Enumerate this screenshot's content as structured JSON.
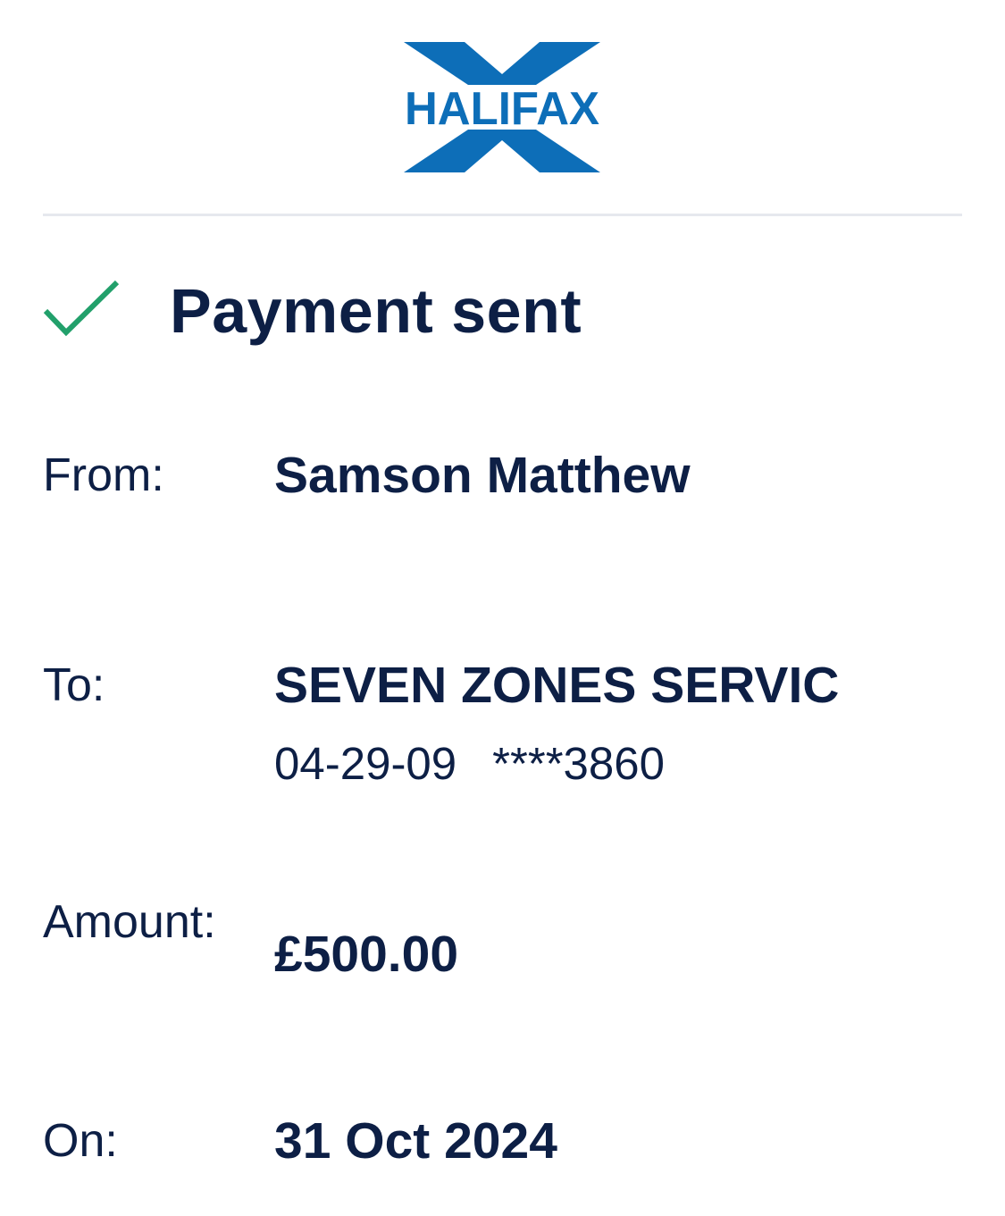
{
  "brand": {
    "name": "HALIFAX",
    "primary_color": "#0d6eb8",
    "text_color": "#0d1f45",
    "success_color": "#22a06b"
  },
  "status": {
    "icon": "check-icon",
    "title": "Payment sent"
  },
  "details": {
    "from": {
      "label": "From:",
      "value": "Samson Matthew"
    },
    "to": {
      "label": "To:",
      "value": "SEVEN ZONES SERVIC",
      "sort_code": "04-29-09",
      "account": "****3860"
    },
    "amount": {
      "label": "Amount:",
      "value": "£500.00"
    },
    "on": {
      "label": "On:",
      "value": "31 Oct 2024"
    }
  }
}
